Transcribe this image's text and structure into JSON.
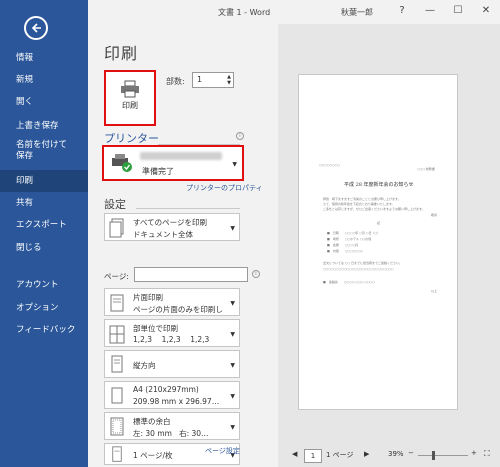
{
  "titlebar": {
    "title": "文書 1 - Word",
    "user": "秋葉一郎",
    "help": "?",
    "minimize": "—",
    "maximize": "☐",
    "close": "✕"
  },
  "sidebar": {
    "items": [
      {
        "label": "情報"
      },
      {
        "label": "新規"
      },
      {
        "label": "開く"
      },
      {
        "label": "上書き保存"
      },
      {
        "label": "名前を付けて\n保存"
      },
      {
        "label": "印刷"
      },
      {
        "label": "共有"
      },
      {
        "label": "エクスポート"
      },
      {
        "label": "閉じる"
      },
      {
        "label": "アカウント"
      },
      {
        "label": "オプション"
      },
      {
        "label": "フィードバック"
      }
    ]
  },
  "print": {
    "heading": "印刷",
    "button_label": "印刷",
    "copies_label": "部数:",
    "copies_value": "1",
    "printer_heading": "プリンター",
    "printer_status": "準備完了",
    "printer_properties": "プリンターのプロパティ",
    "settings_heading": "設定",
    "pages_label": "ページ:",
    "page_setup": "ページ設定"
  },
  "settings": [
    {
      "line1": "すべてのページを印刷",
      "line2": "ドキュメント全体",
      "icon": "pages-icon"
    },
    {
      "line1": "片面印刷",
      "line2": "ページの片面のみを印刷し…",
      "icon": "single-sided-icon"
    },
    {
      "line1": "部単位で印刷",
      "line2": "1,2,3    1,2,3    1,2,3",
      "icon": "collated-icon"
    },
    {
      "line1": "縦方向",
      "line2": "",
      "icon": "portrait-icon"
    },
    {
      "line1": "A4 (210x297mm)",
      "line2": "209.98 mm x 296.97…",
      "icon": "paper-size-icon"
    },
    {
      "line1": "標準の余白",
      "line2": "左: 30 mm   右: 30…",
      "icon": "margins-icon"
    },
    {
      "line1": "1 ページ/枚",
      "line2": "",
      "icon": "pages-per-sheet-icon"
    }
  ],
  "preview": {
    "page_value": "1",
    "page_total": "1 ページ",
    "zoom": "39%",
    "doc_title": "平成 28 年度新年会のお知らせ"
  },
  "colors": {
    "accent": "#2b579a",
    "highlight": "#e01010"
  }
}
